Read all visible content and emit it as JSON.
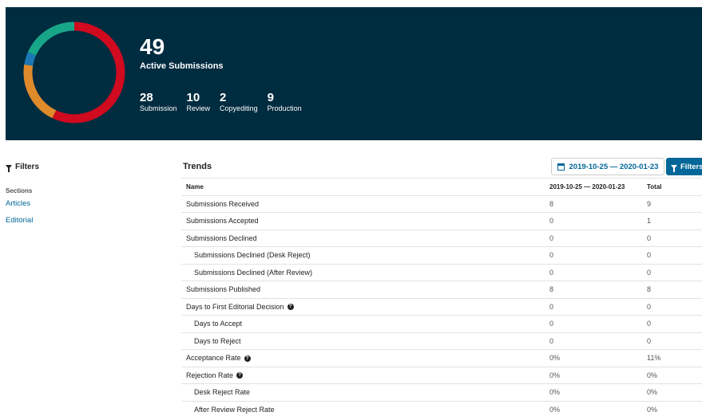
{
  "summary": {
    "total": "49",
    "total_label": "Active Submissions",
    "stages": [
      {
        "count": "28",
        "label": "Submission",
        "color": "#d00a1f"
      },
      {
        "count": "10",
        "label": "Review",
        "color": "#e08b2b"
      },
      {
        "count": "2",
        "label": "Copyediting",
        "color": "#1b77b5"
      },
      {
        "count": "9",
        "label": "Production",
        "color": "#18a689"
      }
    ]
  },
  "sidebar": {
    "filters_label": "Filters",
    "sections_label": "Sections",
    "sections": [
      "Articles",
      "Editorial"
    ]
  },
  "trends": {
    "title": "Trends",
    "date_range": "2019-10-25 — 2020-01-23",
    "filters_button": "Filters",
    "columns": [
      "Name",
      "2019-10-25 — 2020-01-23",
      "Total"
    ],
    "rows": [
      {
        "name": "Submissions Received",
        "range": "8",
        "total": "9",
        "indent": false,
        "help": false
      },
      {
        "name": "Submissions Accepted",
        "range": "0",
        "total": "1",
        "indent": false,
        "help": false
      },
      {
        "name": "Submissions Declined",
        "range": "0",
        "total": "0",
        "indent": false,
        "help": false
      },
      {
        "name": "Submissions Declined (Desk Reject)",
        "range": "0",
        "total": "0",
        "indent": true,
        "help": false
      },
      {
        "name": "Submissions Declined (After Review)",
        "range": "0",
        "total": "0",
        "indent": true,
        "help": false
      },
      {
        "name": "Submissions Published",
        "range": "8",
        "total": "8",
        "indent": false,
        "help": false
      },
      {
        "name": "Days to First Editorial Decision",
        "range": "0",
        "total": "0",
        "indent": false,
        "help": true
      },
      {
        "name": "Days to Accept",
        "range": "0",
        "total": "0",
        "indent": true,
        "help": false
      },
      {
        "name": "Days to Reject",
        "range": "0",
        "total": "0",
        "indent": true,
        "help": false
      },
      {
        "name": "Acceptance Rate",
        "range": "0%",
        "total": "11%",
        "indent": false,
        "help": true
      },
      {
        "name": "Rejection Rate",
        "range": "0%",
        "total": "0%",
        "indent": false,
        "help": true
      },
      {
        "name": "Desk Reject Rate",
        "range": "0%",
        "total": "0%",
        "indent": true,
        "help": false
      },
      {
        "name": "After Review Reject Rate",
        "range": "0%",
        "total": "0%",
        "indent": true,
        "help": false
      }
    ]
  }
}
